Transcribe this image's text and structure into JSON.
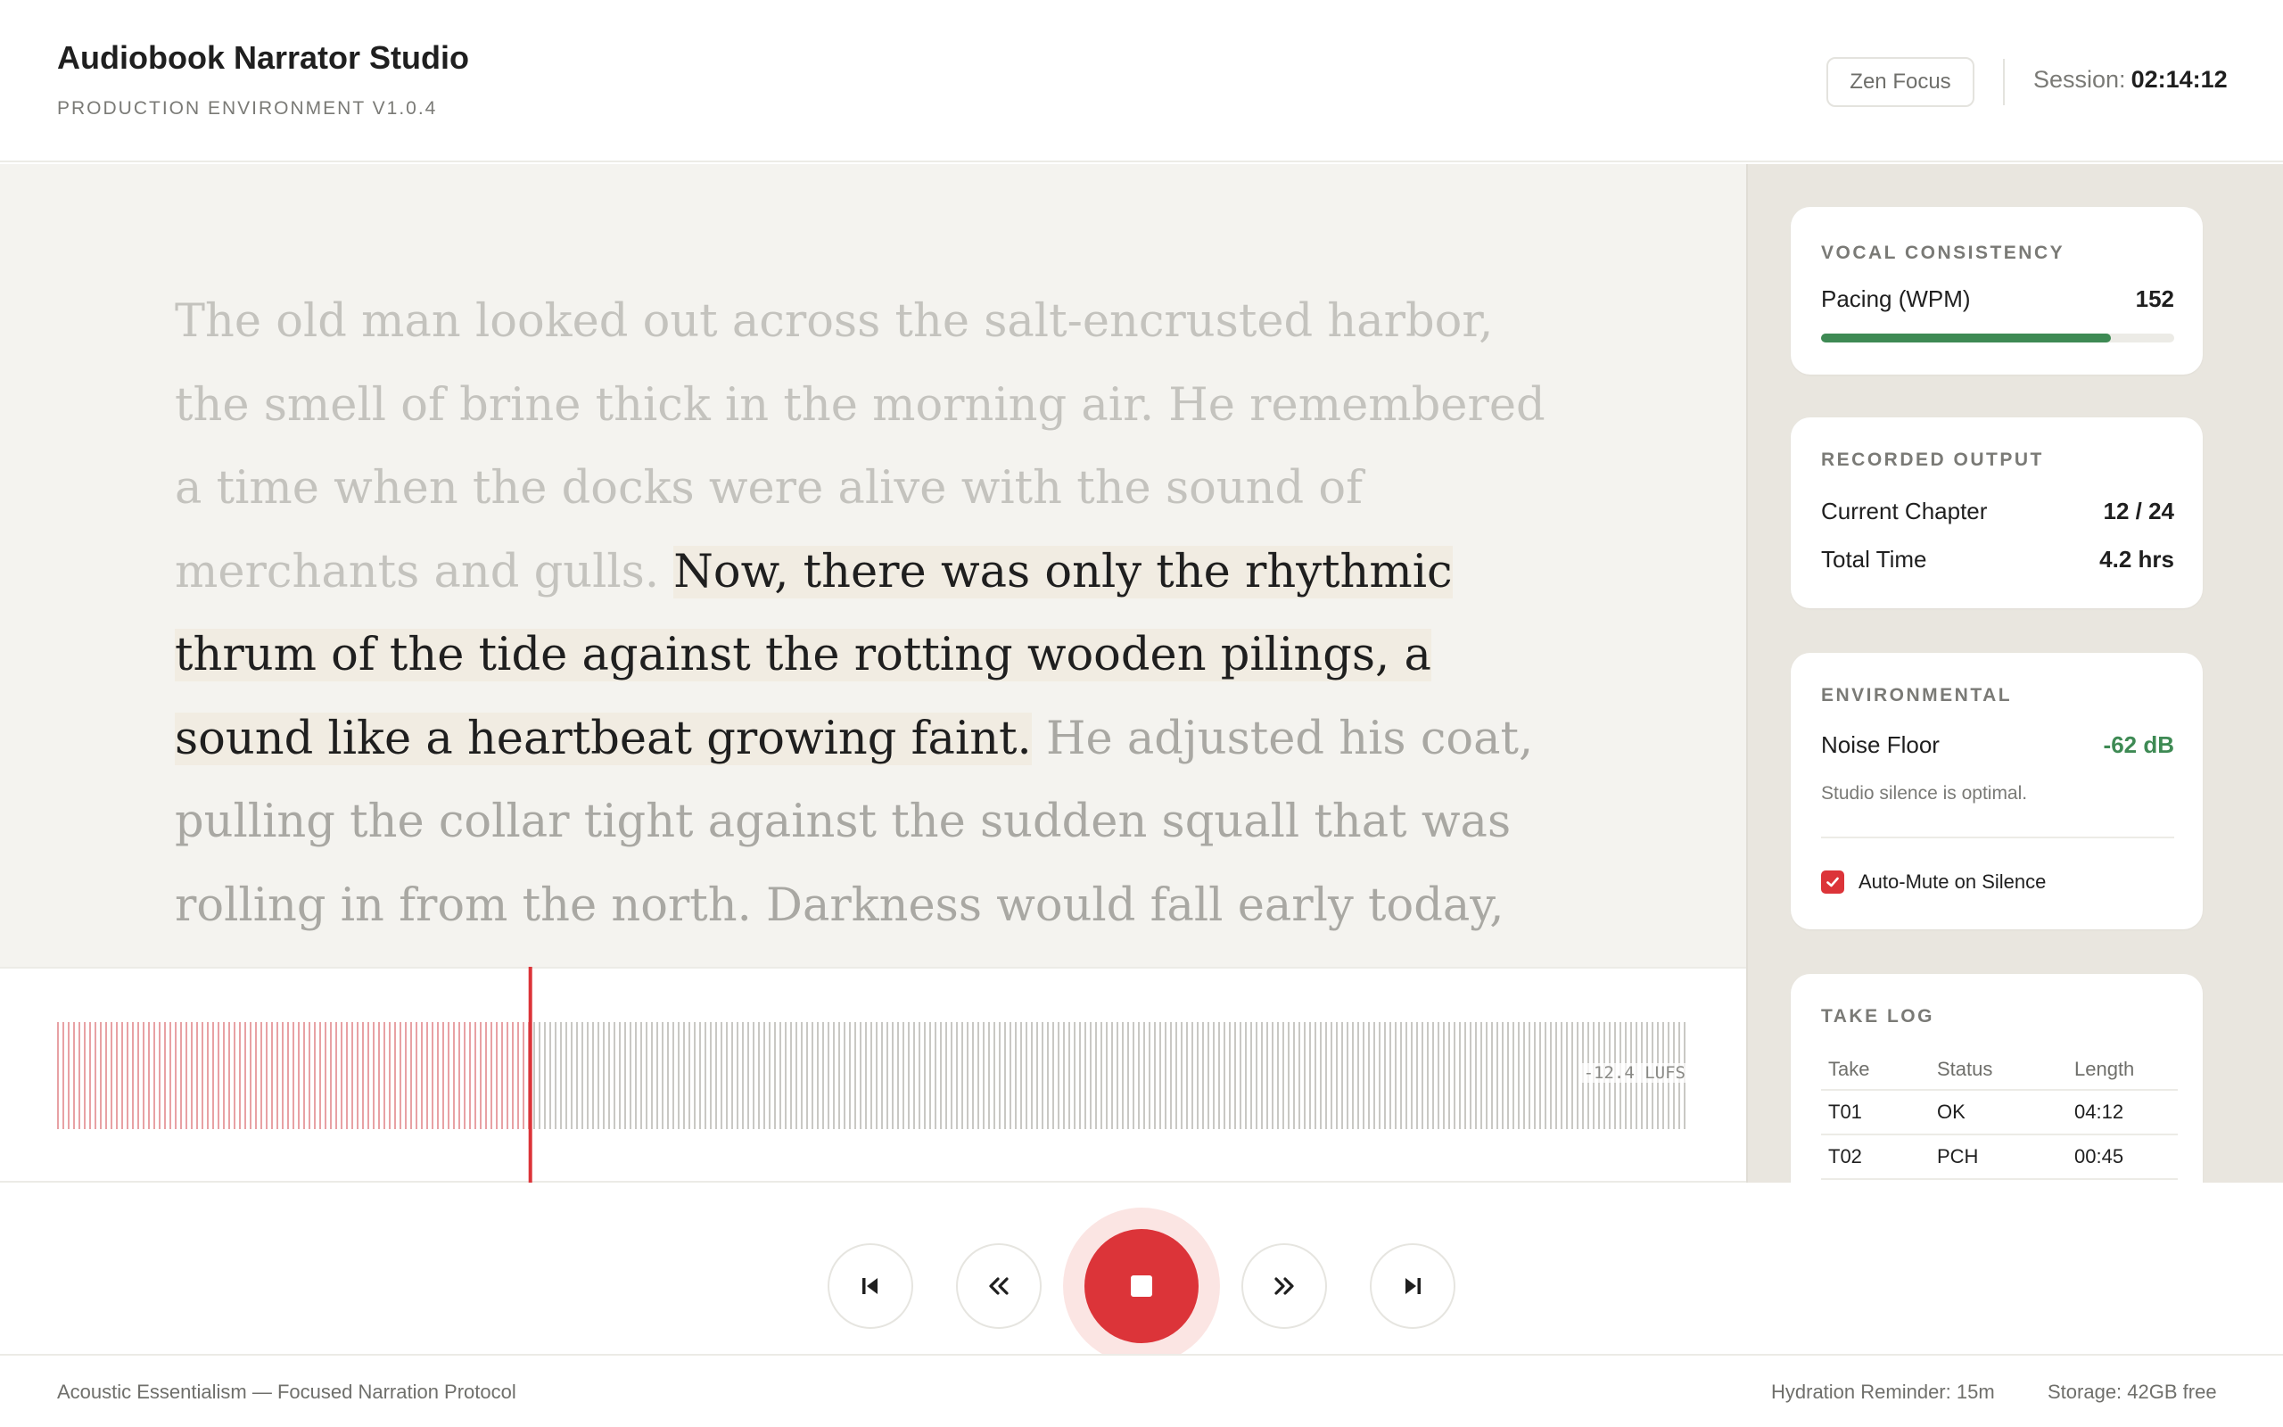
{
  "app": {
    "title": "Audiobook Narrator Studio",
    "subtitle": "PRODUCTION ENVIRONMENT V1.0.4"
  },
  "header": {
    "zen_label": "Zen Focus",
    "session_label": "Session:",
    "session_time": "02:14:12"
  },
  "manuscript": {
    "read_text": "The old man looked out across the salt-encrusted harbor, the smell of brine thick in the morning air. He remembered a time when the docks were alive with the sound of merchants and gulls.",
    "current_text": "Now, there was only the rhythmic thrum of the tide against the rotting wooden pilings, a sound like a heartbeat growing faint.",
    "upcoming_text": "He adjusted his coat, pulling the collar tight against the sudden squall that was rolling in from the north. Darkness would fall early today, and he still had many pages left in his account before the night claimed the last of the light."
  },
  "waveform": {
    "loudness": "-12.4 LUFS",
    "progress": 0.29,
    "played_color": "#e8a1a4",
    "unplayed_color": "#c9c8c4",
    "playhead_color": "#dc3439"
  },
  "transport": {
    "buttons": [
      {
        "name": "skip-to-start",
        "icon": "skip-back-icon"
      },
      {
        "name": "rewind",
        "icon": "rewind-icon"
      },
      {
        "name": "stop",
        "icon": "stop-icon"
      },
      {
        "name": "fast-forward",
        "icon": "fast-forward-icon"
      },
      {
        "name": "skip-to-end",
        "icon": "skip-forward-icon"
      }
    ]
  },
  "footer": {
    "protocol": "Acoustic Essentialism — Focused Narration Protocol",
    "hydration": "Hydration Reminder: 15m",
    "storage": "Storage: 42GB free"
  },
  "vocal": {
    "title": "VOCAL CONSISTENCY",
    "pacing_label": "Pacing (WPM)",
    "pacing_value": "152",
    "pacing_level": 0.82
  },
  "output": {
    "title": "RECORDED OUTPUT",
    "chapter_label": "Current Chapter",
    "chapter_value": "12 / 24",
    "total_label": "Total Time",
    "total_value": "4.2 hrs"
  },
  "environment": {
    "title": "ENVIRONMENTAL",
    "noise_label": "Noise Floor",
    "noise_value": "-62 dB",
    "noise_note": "Studio silence is optimal.",
    "automute_label": "Auto-Mute on Silence",
    "automute_checked": true
  },
  "takes": {
    "title": "TAKE LOG",
    "columns": [
      "Take",
      "Status",
      "Length"
    ],
    "rows": [
      {
        "take": "T01",
        "status": "OK",
        "length": "04:12"
      },
      {
        "take": "T02",
        "status": "PCH",
        "length": "00:45"
      }
    ]
  },
  "colors": {
    "accent_red": "#dc3439",
    "good_green": "#3e8a54",
    "warn_orange": "#d68a1a"
  }
}
